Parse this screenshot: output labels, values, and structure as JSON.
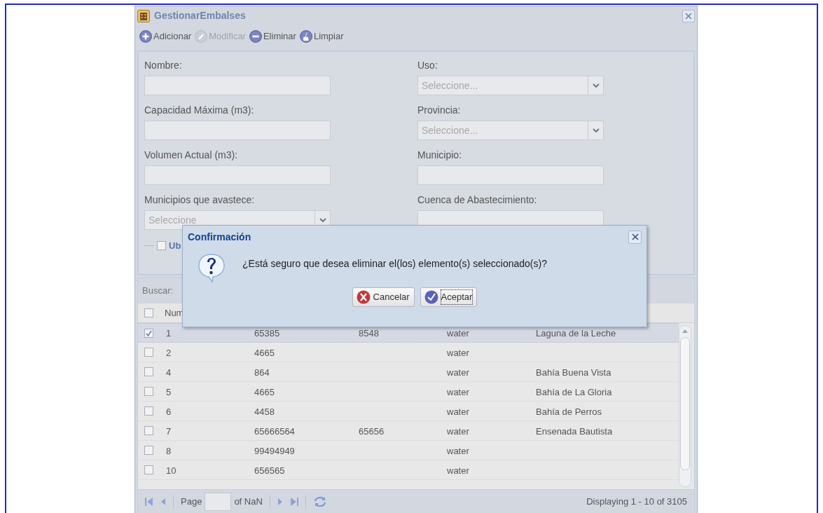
{
  "window": {
    "title": "GestionarEmbalses"
  },
  "toolbar": [
    {
      "kind": "add",
      "label": "Adicionar",
      "disabled": false
    },
    {
      "kind": "edit",
      "label": "Modificar",
      "disabled": true
    },
    {
      "kind": "delete",
      "label": "Eliminar",
      "disabled": false
    },
    {
      "kind": "clear",
      "label": "Limpiar",
      "disabled": false
    }
  ],
  "form": {
    "left": [
      {
        "kind": "text",
        "label": "Nombre:"
      },
      {
        "kind": "text",
        "label": "Capacidad Máxima (m3):"
      },
      {
        "kind": "text",
        "label": "Volumen Actual (m3):"
      },
      {
        "kind": "combo",
        "label": "Municipios que avastece:",
        "placeholder": "Seleccione"
      }
    ],
    "right": [
      {
        "kind": "combo",
        "label": "Uso:",
        "placeholder": "Seleccione..."
      },
      {
        "kind": "combo",
        "label": "Provincia:",
        "placeholder": "Seleccione..."
      },
      {
        "kind": "text",
        "label": "Municipio:"
      },
      {
        "kind": "text",
        "label": "Cuenca de Abastecimiento:"
      }
    ],
    "fieldset": {
      "label": "Ub",
      "checked": false
    }
  },
  "grid": {
    "search_label": "Buscar:",
    "all_checked": false,
    "columns": [
      "Num"
    ],
    "rows": [
      {
        "selected": true,
        "cells": [
          "1",
          "65385",
          "8548",
          "water",
          "Laguna de la Leche"
        ]
      },
      {
        "selected": false,
        "cells": [
          "2",
          "4665",
          "",
          "water",
          ""
        ]
      },
      {
        "selected": false,
        "cells": [
          "4",
          "864",
          "",
          "water",
          "Bahía Buena Vista"
        ]
      },
      {
        "selected": false,
        "cells": [
          "5",
          "4665",
          "",
          "water",
          "Bahía de La Gloria"
        ]
      },
      {
        "selected": false,
        "cells": [
          "6",
          "4458",
          "",
          "water",
          "Bahía de Perros"
        ]
      },
      {
        "selected": false,
        "cells": [
          "7",
          "65666564",
          "65656",
          "water",
          "Ensenada Bautista"
        ]
      },
      {
        "selected": false,
        "cells": [
          "8",
          "99494949",
          "",
          "water",
          ""
        ]
      },
      {
        "selected": false,
        "cells": [
          "10",
          "656565",
          "",
          "water",
          ""
        ]
      }
    ]
  },
  "paging": {
    "page_label": "Page",
    "of_label": "of NaN",
    "display": "Displaying 1 - 10 of 3105"
  },
  "dialog": {
    "title": "Confirmación",
    "message": "¿Está seguro que desea eliminar el(los) elemento(s) seleccionado(s)?",
    "buttons": [
      {
        "kind": "cancel",
        "label": "Cancelar",
        "focused": false
      },
      {
        "kind": "ok",
        "label": "Aceptar",
        "focused": true
      }
    ]
  }
}
